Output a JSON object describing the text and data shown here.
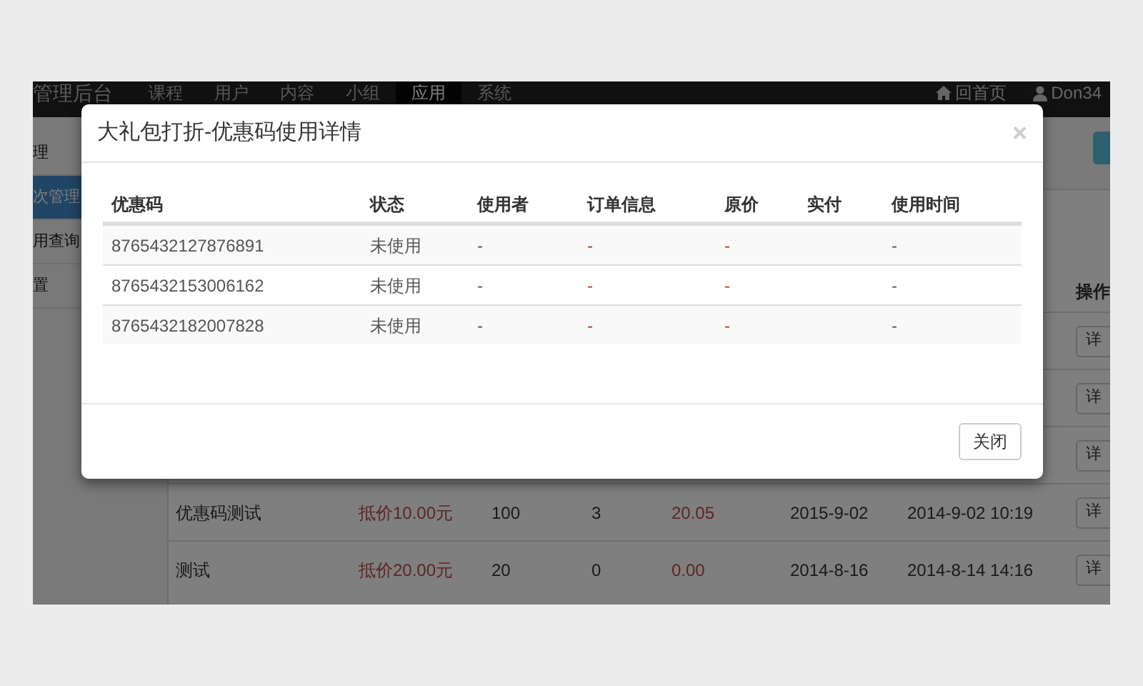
{
  "navbar": {
    "brand": "管理后台",
    "items": [
      {
        "label": "课程",
        "selected": false
      },
      {
        "label": "用户",
        "selected": false
      },
      {
        "label": "内容",
        "selected": false
      },
      {
        "label": "小组",
        "selected": false
      },
      {
        "label": "应用",
        "selected": true
      },
      {
        "label": "系统",
        "selected": false
      }
    ],
    "links": [
      {
        "kind": "home",
        "label": "回首页"
      },
      {
        "kind": "user",
        "label": "Don34"
      }
    ]
  },
  "sidebar": {
    "items": [
      {
        "label": "理",
        "selected": false
      },
      {
        "label": "次管理",
        "selected": true
      },
      {
        "label": "用查询",
        "selected": false
      },
      {
        "label": "置",
        "selected": false
      }
    ]
  },
  "table": {
    "action_header": "操作",
    "rows": [
      {
        "action": "详"
      },
      {
        "action": "详"
      },
      {
        "action": "详"
      },
      {
        "cells": [
          "优惠码测试",
          "抵价10.00元",
          "100",
          "3",
          "20.05",
          "2015-9-02",
          "2014-9-02 10:19"
        ],
        "action": "详"
      },
      {
        "cells": [
          "测试",
          "抵价20.00元",
          "20",
          "0",
          "0.00",
          "2014-8-16",
          "2014-8-14 14:16"
        ],
        "action": "详"
      }
    ]
  },
  "modal": {
    "title": "大礼包打折-优惠码使用详情",
    "close_icon": "×",
    "columns": [
      "优惠码",
      "状态",
      "使用者",
      "订单信息",
      "原价",
      "实付",
      "使用时间"
    ],
    "rows": [
      {
        "code": "8765432127876891",
        "status": "未使用",
        "user": "-",
        "order_info": "-",
        "original_price": "-",
        "used_time": "-"
      },
      {
        "code": "8765432153006162",
        "status": "未使用",
        "user": "-",
        "order_info": "-",
        "original_price": "-",
        "used_time": "-"
      },
      {
        "code": "8765432182007828",
        "status": "未使用",
        "user": "-",
        "order_info": "-",
        "original_price": "-",
        "used_time": "-"
      }
    ],
    "close_button": "关闭"
  }
}
